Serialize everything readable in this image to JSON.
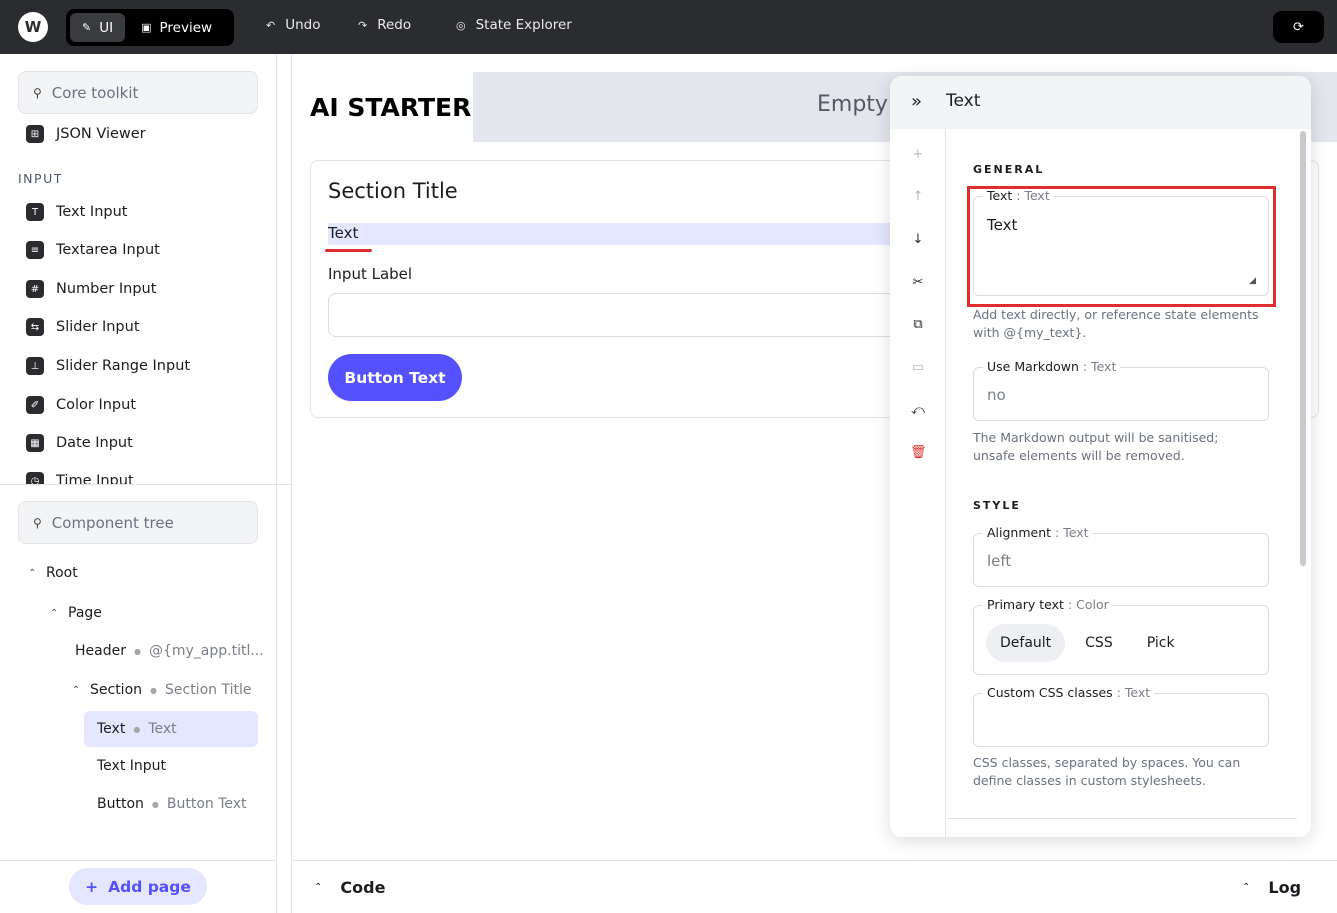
{
  "topbar": {
    "logo": "W",
    "mode_ui": "UI",
    "mode_preview": "Preview",
    "undo": "Undo",
    "redo": "Redo",
    "state_explorer": "State Explorer"
  },
  "toolkit": {
    "search_placeholder": "Core toolkit",
    "items_top": [
      {
        "label": "JSON Viewer",
        "icon": "json-viewer-icon"
      }
    ],
    "heading": "INPUT",
    "items": [
      {
        "label": "Text Input",
        "icon": "text-input-icon"
      },
      {
        "label": "Textarea Input",
        "icon": "textarea-icon"
      },
      {
        "label": "Number Input",
        "icon": "number-input-icon"
      },
      {
        "label": "Slider Input",
        "icon": "slider-icon"
      },
      {
        "label": "Slider Range Input",
        "icon": "slider-range-icon"
      },
      {
        "label": "Color Input",
        "icon": "color-icon"
      },
      {
        "label": "Date Input",
        "icon": "date-icon"
      },
      {
        "label": "Time Input",
        "icon": "time-icon"
      }
    ]
  },
  "tree": {
    "search_placeholder": "Component tree",
    "rows": [
      {
        "label": "Root",
        "sub": ""
      },
      {
        "label": "Page",
        "sub": ""
      },
      {
        "label": "Header",
        "sub": "@{my_app.titl..."
      },
      {
        "label": "Section",
        "sub": "Section Title"
      },
      {
        "label": "Text",
        "sub": "Text"
      },
      {
        "label": "Text Input",
        "sub": ""
      },
      {
        "label": "Button",
        "sub": "Button Text"
      }
    ],
    "add_page": "Add page"
  },
  "canvas": {
    "app_title": "AI STARTER",
    "header_placeholder": "Empty",
    "section_title": "Section Title",
    "text": "Text",
    "input_label": "Input Label",
    "button_text": "Button Text"
  },
  "bottombar": {
    "code": "Code",
    "log": "Log"
  },
  "settings": {
    "title": "Text",
    "general_heading": "GENERAL",
    "text_field": {
      "label": "Text",
      "type": ": Text",
      "value": "Text",
      "help": "Add text directly, or reference state elements with @{my_text}."
    },
    "markdown_field": {
      "label": "Use Markdown",
      "type": ": Text",
      "value": "no",
      "help": "The Markdown output will be sanitised; unsafe elements will be removed."
    },
    "style_heading": "STYLE",
    "alignment_field": {
      "label": "Alignment",
      "type": ": Text",
      "value": "left"
    },
    "primary_text_field": {
      "label": "Primary text",
      "type": ": Color",
      "options": [
        "Default",
        "CSS",
        "Pick"
      ],
      "selected": "Default"
    },
    "css_field": {
      "label": "Custom CSS classes",
      "type": ": Text",
      "help": "CSS classes, separated by spaces. You can define classes in custom stylesheets."
    }
  },
  "colors": {
    "accent": "#5551ff",
    "accent_light": "#e4e7ff",
    "danger": "#e02e2e",
    "topbar": "#2b2c2f"
  }
}
